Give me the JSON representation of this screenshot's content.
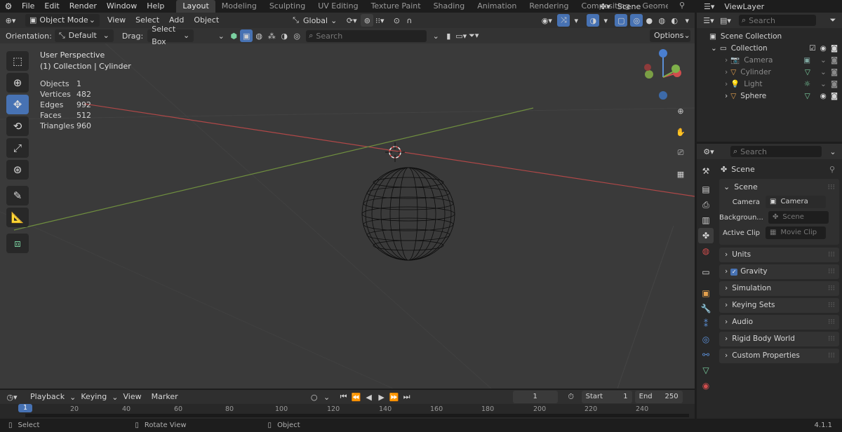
{
  "menubar": {
    "items": [
      "File",
      "Edit",
      "Render",
      "Window",
      "Help"
    ],
    "workspaces": [
      "Layout",
      "Modeling",
      "Sculpting",
      "UV Editing",
      "Texture Paint",
      "Shading",
      "Animation",
      "Rendering",
      "Compositing",
      "Geomet"
    ],
    "scene_label": "Scene",
    "viewlayer_label": "ViewLayer"
  },
  "viewport_header": {
    "mode": "Object Mode",
    "menus": [
      "View",
      "Select",
      "Add",
      "Object"
    ],
    "transform_orientation": "Global"
  },
  "tool_settings": {
    "orientation_label": "Orientation:",
    "orientation_value": "Default",
    "drag_label": "Drag:",
    "drag_value": "Select Box",
    "search_placeholder": "Search",
    "options_label": "Options"
  },
  "overlay": {
    "view_name": "User Perspective",
    "context": "(1) Collection | Cylinder",
    "stats": [
      {
        "label": "Objects",
        "value": "1"
      },
      {
        "label": "Vertices",
        "value": "482"
      },
      {
        "label": "Edges",
        "value": "992"
      },
      {
        "label": "Faces",
        "value": "512"
      },
      {
        "label": "Triangles",
        "value": "960"
      }
    ]
  },
  "outliner": {
    "search_placeholder": "Search",
    "root": "Scene Collection",
    "collection": "Collection",
    "items": [
      {
        "name": "Camera",
        "icon": "camera-icon",
        "color": "#e5a14e"
      },
      {
        "name": "Cylinder",
        "icon": "mesh-icon",
        "color": "#e5a14e"
      },
      {
        "name": "Light",
        "icon": "light-icon",
        "color": "#e5a14e"
      },
      {
        "name": "Sphere",
        "icon": "mesh-icon",
        "color": "#e5a14e"
      }
    ]
  },
  "properties": {
    "search_placeholder": "Search",
    "breadcrumb": "Scene",
    "panel_title": "Scene",
    "fields": [
      {
        "label": "Camera",
        "value": "Camera"
      },
      {
        "label": "Backgroun...",
        "value": "Scene"
      },
      {
        "label": "Active Clip",
        "value": "Movie Clip"
      }
    ],
    "sections": [
      "Units",
      "Gravity",
      "Simulation",
      "Keying Sets",
      "Audio",
      "Rigid Body World",
      "Custom Properties"
    ]
  },
  "timeline": {
    "menus": [
      "Playback",
      "Keying",
      "View",
      "Marker"
    ],
    "current_frame": "1",
    "start_label": "Start",
    "start_value": "1",
    "end_label": "End",
    "end_value": "250",
    "ruler": [
      "1",
      "20",
      "40",
      "60",
      "80",
      "100",
      "120",
      "140",
      "160",
      "180",
      "200",
      "220",
      "240"
    ]
  },
  "statusbar": {
    "select": "Select",
    "rotate": "Rotate View",
    "object": "Object",
    "version": "4.1.1"
  },
  "colors": {
    "accent": "#4772b3",
    "x_axis": "#c25050",
    "y_axis": "#7fa34a",
    "object_orange": "#e5a14e"
  }
}
